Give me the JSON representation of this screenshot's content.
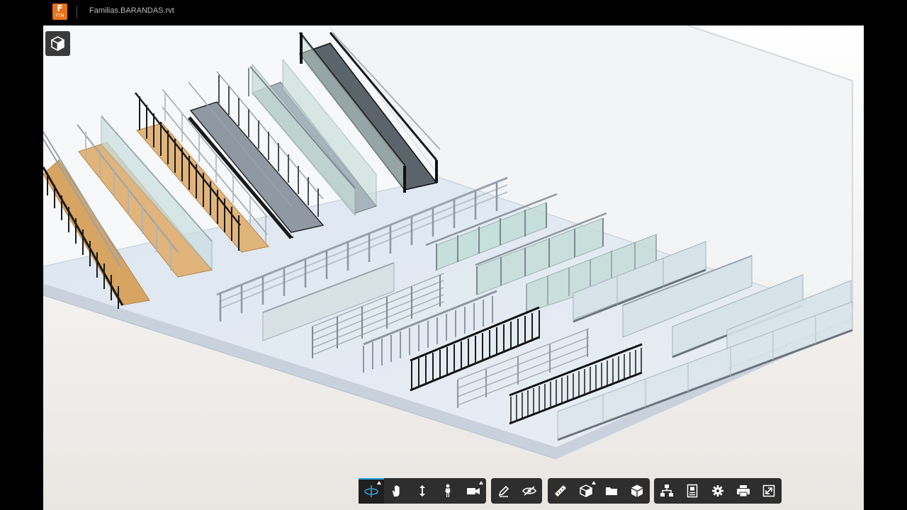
{
  "app": {
    "logo_letter": "F",
    "logo_sub": "FTM",
    "file_title": "Familias.BARANDAS.rvt"
  },
  "toolbar": {
    "groups": [
      [
        {
          "name": "orbit",
          "icon": "orbit-icon",
          "active": true,
          "has_flyout": true
        },
        {
          "name": "pan",
          "icon": "hand-icon",
          "active": false,
          "has_flyout": false
        },
        {
          "name": "zoom",
          "icon": "up-down-arrow-icon",
          "active": false,
          "has_flyout": false
        },
        {
          "name": "first-person",
          "icon": "person-icon",
          "active": false,
          "has_flyout": false
        },
        {
          "name": "camera",
          "icon": "camera-icon",
          "active": false,
          "has_flyout": true
        }
      ],
      [
        {
          "name": "markup",
          "icon": "pencil-icon",
          "active": false,
          "has_flyout": false
        },
        {
          "name": "visibility",
          "icon": "eye-slash-icon",
          "active": false,
          "has_flyout": false
        }
      ],
      [
        {
          "name": "measure",
          "icon": "ruler-icon",
          "active": false,
          "has_flyout": false
        },
        {
          "name": "section",
          "icon": "section-box-icon",
          "active": false,
          "has_flyout": true
        },
        {
          "name": "explode",
          "icon": "folder-icon",
          "active": false,
          "has_flyout": false
        },
        {
          "name": "model",
          "icon": "cube-icon",
          "active": false,
          "has_flyout": false
        }
      ],
      [
        {
          "name": "model-browser",
          "icon": "hierarchy-icon",
          "active": false,
          "has_flyout": false
        },
        {
          "name": "properties",
          "icon": "properties-icon",
          "active": false,
          "has_flyout": false
        },
        {
          "name": "settings",
          "icon": "gear-icon",
          "active": false,
          "has_flyout": false
        },
        {
          "name": "print",
          "icon": "printer-icon",
          "active": false,
          "has_flyout": false
        },
        {
          "name": "fullscreen",
          "icon": "fullscreen-icon",
          "active": false,
          "has_flyout": false
        }
      ]
    ]
  },
  "colors": {
    "accent": "#2aa3e0",
    "toolbar_bg": "#2e2e2e",
    "logo": "#e8731c",
    "floor": "#d9e3ee",
    "wood": "#d7a461",
    "glass": "#c6ddd6",
    "metal": "#2a2a2a"
  }
}
